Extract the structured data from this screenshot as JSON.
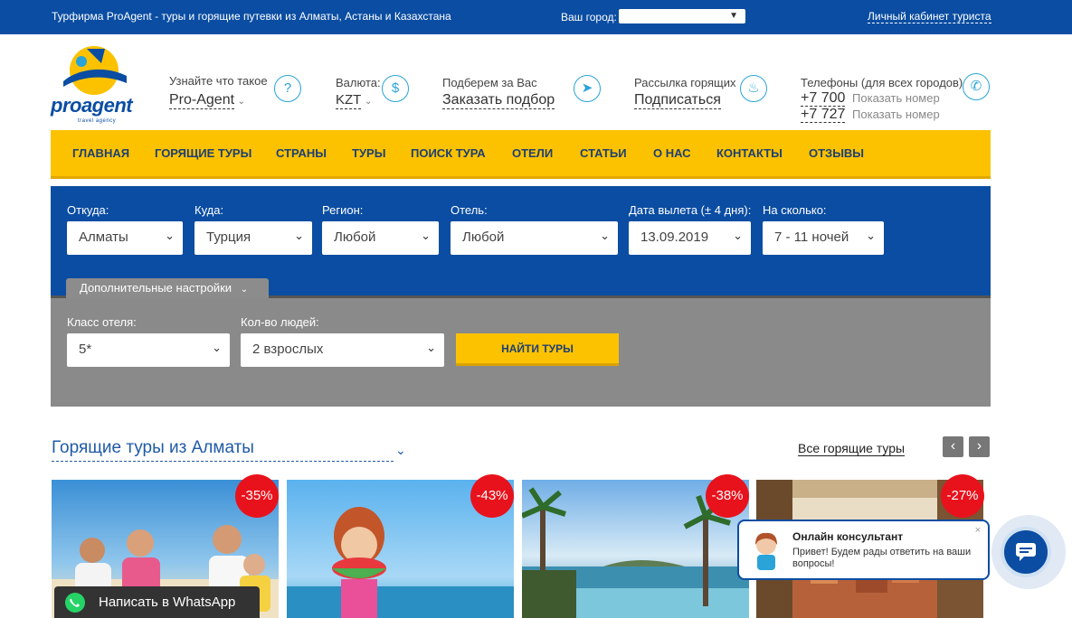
{
  "topbar": {
    "tagline": "Турфирма ProAgent - туры и горящие путевки из Алматы, Астаны и Казахстана",
    "city_label": "Ваш город:",
    "city_value": "",
    "cabinet": "Личный кабинет туриста"
  },
  "logo": {
    "name": "proagent",
    "sub": "travel agency"
  },
  "header": {
    "about_label": "Узнайте что такое",
    "about_value": "Pro-Agent",
    "currency_label": "Валюта:",
    "currency_value": "KZT",
    "pick_label": "Подберем за Вас",
    "pick_value": "Заказать подбор",
    "mail_label": "Рассылка горящих",
    "mail_value": "Подписаться",
    "phones_label": "Телефоны (для всех городов)",
    "phones": [
      {
        "number": "+7 700",
        "show": "Показать номер"
      },
      {
        "number": "+7 727",
        "show": "Показать номер"
      }
    ]
  },
  "nav": {
    "items": [
      "ГЛАВНАЯ",
      "ГОРЯЩИЕ ТУРЫ",
      "СТРАНЫ",
      "ТУРЫ",
      "ПОИСК ТУРА",
      "ОТЕЛИ",
      "СТАТЬИ",
      "О НАС",
      "КОНТАКТЫ",
      "ОТЗЫВЫ"
    ]
  },
  "search": {
    "from_label": "Откуда:",
    "from_value": "Алматы",
    "to_label": "Куда:",
    "to_value": "Турция",
    "region_label": "Регион:",
    "region_value": "Любой",
    "hotel_label": "Отель:",
    "hotel_value": "Любой",
    "date_label": "Дата вылета (± 4 дня):",
    "date_value": "13.09.2019",
    "nights_label": "На сколько:",
    "nights_value": "7 - 11 ночей",
    "extra_tab": "Дополнительные настройки",
    "class_label": "Класс отеля:",
    "class_value": "5*",
    "people_label": "Кол-во людей:",
    "people_value": "2 взрослых",
    "find_button": "НАЙТИ ТУРЫ"
  },
  "hot": {
    "title": "Горящие туры из Алматы",
    "all_link": "Все горящие туры",
    "cards": [
      {
        "discount": "-35%"
      },
      {
        "discount": "-43%"
      },
      {
        "discount": "-38%"
      },
      {
        "discount": "-27%"
      }
    ]
  },
  "widgets": {
    "whatsapp": "Написать в WhatsApp",
    "consult_title": "Онлайн консультант",
    "consult_msg": "Привет! Будем рады ответить на ваши вопросы!",
    "close": "×"
  },
  "colors": {
    "brand_blue": "#0a4da2",
    "brand_yellow": "#fcc200",
    "sale_red": "#e8121c"
  }
}
